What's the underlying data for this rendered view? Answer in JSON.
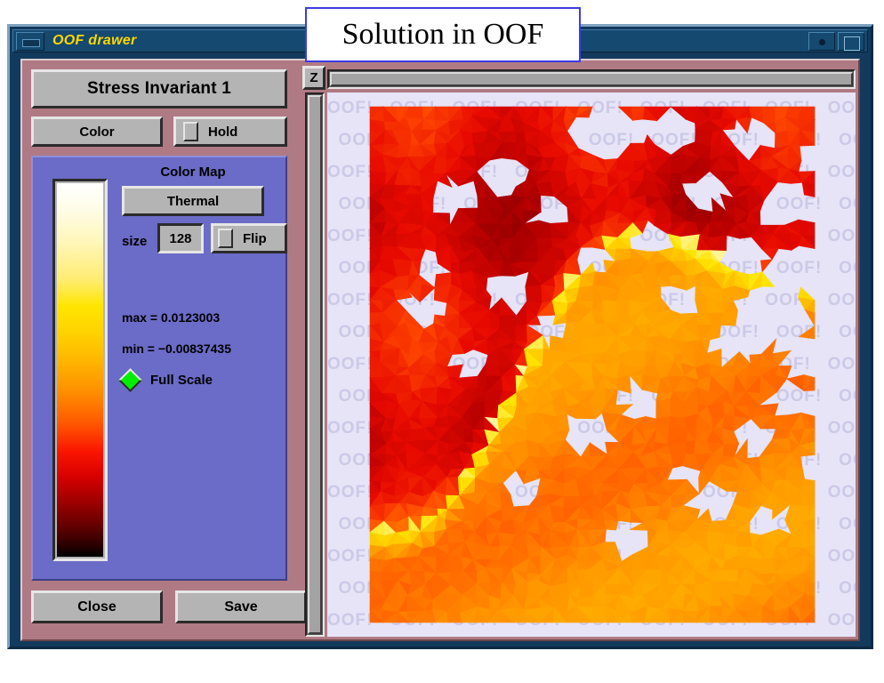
{
  "overlay": {
    "caption": "Solution in OOF",
    "border_color": "#3c3ce0"
  },
  "window": {
    "title": "OOF drawer",
    "title_color": "#ffd700",
    "frame_color": "#15496f",
    "panel_color": "#b07a84",
    "titlebar_buttons": [
      {
        "name": "minimize",
        "glyph": "minimize"
      },
      {
        "name": "iconify",
        "glyph": "dot"
      },
      {
        "name": "maximize",
        "glyph": "square"
      }
    ]
  },
  "controls": {
    "quantity_button": "Stress Invariant 1",
    "color_button": "Color",
    "hold_button": "Hold",
    "hold_checked": false,
    "close_button": "Close",
    "save_button": "Save"
  },
  "colormap": {
    "panel_color": "#6b6bc8",
    "label": "Color Map",
    "selected": "Thermal",
    "options": [
      "Thermal"
    ],
    "size_label": "size",
    "size_value": "128",
    "flip_label": "Flip",
    "flip_checked": false,
    "max_text": "max = 0.0123003",
    "min_text": "min = −0.00837435",
    "max_value": 0.0123003,
    "min_value": -0.00837435,
    "full_scale_label": "Full Scale",
    "full_scale_on": true,
    "full_scale_color": "#00ee00",
    "bar_stops": [
      "#ffffff",
      "#fff6b8",
      "#ffe500",
      "#ffb400",
      "#ff5a00",
      "#d40000",
      "#6b0000",
      "#000000"
    ]
  },
  "canvas": {
    "zoom_button": "Z",
    "background_color": "#e6e4f6",
    "watermark_text": "OOF!",
    "h_scroll_position": 0,
    "v_scroll_position": 0
  }
}
